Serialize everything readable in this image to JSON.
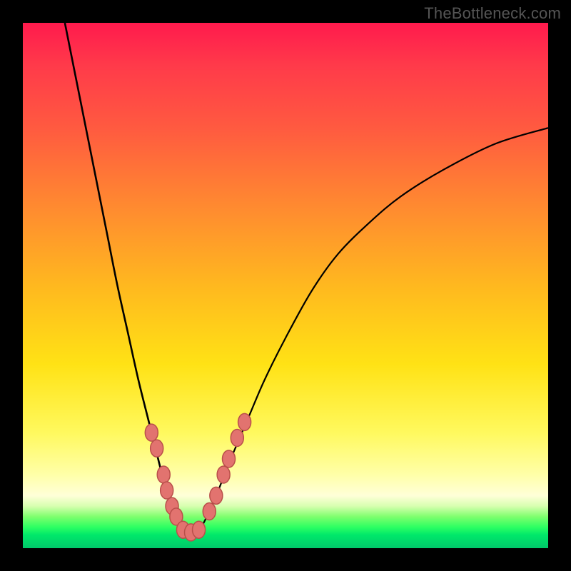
{
  "watermark": "TheBottleneck.com",
  "colors": {
    "frame": "#000000",
    "gradient_top": "#ff1a4d",
    "gradient_bottom": "#00c86a",
    "curve": "#000000",
    "bead_fill": "#e2736f",
    "bead_stroke": "#b94f4a"
  },
  "chart_data": {
    "type": "line",
    "title": "",
    "xlabel": "",
    "ylabel": "",
    "xlim": [
      0,
      100
    ],
    "ylim": [
      0,
      100
    ],
    "grid": false,
    "legend": false,
    "series": [
      {
        "name": "left-branch",
        "x": [
          8,
          10,
          12,
          14,
          16,
          18,
          20,
          22,
          24,
          26,
          27,
          28,
          29,
          30
        ],
        "y": [
          100,
          90,
          80,
          70,
          60,
          50,
          41,
          32,
          24,
          16,
          12,
          9,
          6,
          4
        ]
      },
      {
        "name": "right-branch",
        "x": [
          34,
          36,
          38,
          40,
          43,
          46,
          50,
          55,
          60,
          66,
          72,
          80,
          90,
          100
        ],
        "y": [
          4,
          8,
          13,
          18,
          25,
          32,
          40,
          49,
          56,
          62,
          67,
          72,
          77,
          80
        ]
      },
      {
        "name": "valley-floor",
        "x": [
          30,
          31,
          32,
          33,
          34
        ],
        "y": [
          4,
          3,
          3,
          3,
          4
        ]
      }
    ],
    "annotations": {
      "beads_left": [
        {
          "x": 24.5,
          "y": 22
        },
        {
          "x": 25.5,
          "y": 19
        },
        {
          "x": 26.8,
          "y": 14
        },
        {
          "x": 27.4,
          "y": 11
        },
        {
          "x": 28.4,
          "y": 8
        },
        {
          "x": 29.2,
          "y": 6
        }
      ],
      "beads_right": [
        {
          "x": 35.5,
          "y": 7
        },
        {
          "x": 36.8,
          "y": 10
        },
        {
          "x": 38.2,
          "y": 14
        },
        {
          "x": 39.2,
          "y": 17
        },
        {
          "x": 40.8,
          "y": 21
        },
        {
          "x": 42.2,
          "y": 24
        }
      ],
      "beads_floor": [
        {
          "x": 30.5,
          "y": 3.5
        },
        {
          "x": 32.0,
          "y": 3.0
        },
        {
          "x": 33.5,
          "y": 3.5
        }
      ]
    }
  }
}
